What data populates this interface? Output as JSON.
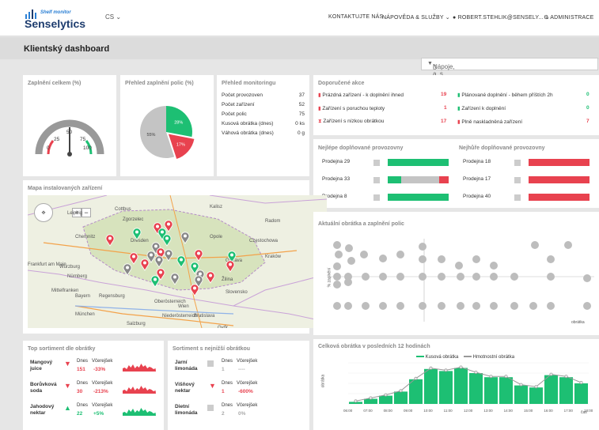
{
  "header": {
    "logo_small": "Shelf monitor",
    "logo_name": "Senselytics",
    "lang": "CS",
    "contact": "KONTAKTUJTE NÁS",
    "help": "NÁPOVĚDA & SLUŽBY",
    "user": "ROBERT.STEHLIK@SENSELY...",
    "admin": "ADMINISTRACE"
  },
  "page": {
    "title": "Klientský dashboard"
  },
  "filter": {
    "value": "Nápoje, a. s."
  },
  "gauge": {
    "title": "Zaplnění celkem (%)",
    "labels": [
      "0",
      "25",
      "50",
      "75",
      "100"
    ],
    "value": 50
  },
  "pie": {
    "title": "Přehled zaplnění polic (%)",
    "slices": [
      {
        "label": "28%",
        "value": 28,
        "color": "#1dbf73"
      },
      {
        "label": "17%",
        "value": 17,
        "color": "#e8424f"
      },
      {
        "label": "55%",
        "value": 55,
        "color": "#c4c4c4"
      }
    ]
  },
  "monitoring": {
    "title": "Přehled monitoringu",
    "rows": [
      {
        "label": "Počet provozoven",
        "value": "37"
      },
      {
        "label": "Počet zařízení",
        "value": "52"
      },
      {
        "label": "Počet polic",
        "value": "75"
      },
      {
        "label": "Kusová obrátka (dnes)",
        "value": "0 ks"
      },
      {
        "label": "Váhová obrátka (dnes)",
        "value": "0 g"
      }
    ]
  },
  "actions": {
    "title": "Doporučené akce",
    "left": [
      {
        "label": "Prázdná zařízení - k doplnění ihned",
        "value": "19"
      },
      {
        "label": "Zařízení s poruchou teploty",
        "value": "1"
      },
      {
        "label": "Zařízení s nízkou obrátkou",
        "value": "17"
      }
    ],
    "right": [
      {
        "label": "Plánované doplnění - během příštích 2h",
        "value": "0"
      },
      {
        "label": "Zařízení k doplnění",
        "value": "0"
      },
      {
        "label": "Plně naskladněná zařízení",
        "value": "7"
      }
    ]
  },
  "best": {
    "title": "Nejlépe doplňované provozovny",
    "rows": [
      {
        "label": "Prodejna 29",
        "green": 1.0
      },
      {
        "label": "Prodejna 33",
        "green": 0.22,
        "gray": 0.62
      },
      {
        "label": "Prodejna 8",
        "green": 1.0
      }
    ]
  },
  "worst": {
    "title": "Nejhůře doplňované provozovny",
    "rows": [
      {
        "label": "Prodejna 18"
      },
      {
        "label": "Prodejna 17"
      },
      {
        "label": "Prodejna 40"
      }
    ]
  },
  "map": {
    "title": "Mapa instalovaných zařízení",
    "places": [
      "Leipzig",
      "Chemnitz",
      "Dresden",
      "Cottbus",
      "Zgorzelec",
      "Kalisz",
      "Radom",
      "Opole",
      "Częstochowa",
      "Kraków",
      "Ostrava",
      "Žilina",
      "Slovensko",
      "Wien",
      "Bratislava",
      "Győr",
      "München",
      "Salzburg",
      "Nürnberg",
      "Würzburg",
      "Mittelfranken",
      "Oberösterreich",
      "Bayern",
      "Frankfurt am Main",
      "Niederösterreich",
      "Regensburg"
    ]
  },
  "scatter": {
    "title": "Aktuální obrátka a zaplnění polic",
    "ylabel": "% zaplnění",
    "xlabel": "obrátka"
  },
  "top": {
    "title": "Top sortiment dle obrátky",
    "dnes": "Dnes",
    "vcera": "Včerejšek",
    "items": [
      {
        "name": "Mangový juice",
        "today": "151",
        "change": "-33%",
        "dir": "down"
      },
      {
        "name": "Borůvková soda",
        "today": "30",
        "change": "-213%",
        "dir": "down"
      },
      {
        "name": "Jahodový nektar",
        "today": "22",
        "change": "+5%",
        "dir": "up"
      }
    ]
  },
  "low": {
    "title": "Sortiment s nejnižší obrátkou",
    "dnes": "Dnes",
    "vcera": "Včerejšek",
    "items": [
      {
        "name": "Jarní limonáda",
        "today": "1",
        "change": "----",
        "dir": "none"
      },
      {
        "name": "Višňový nektar",
        "today": "1",
        "change": "-600%",
        "dir": "down"
      },
      {
        "name": "Dietní limonáda",
        "today": "2",
        "change": "0%",
        "dir": "none"
      }
    ]
  },
  "turnover": {
    "title": "Celková obrátka v posledních 12 hodinách",
    "legend1": "Kusová obrátka",
    "legend2": "Hmotnostní obrátka",
    "ylabel": "obrátka",
    "xunit": "čas",
    "times": [
      "06:00",
      "07:00",
      "08:00",
      "09:00",
      "10:00",
      "11:00",
      "12:00",
      "13:00",
      "14:00",
      "15:00",
      "16:00",
      "17:00",
      "18:00"
    ]
  },
  "chart_data": {
    "type": "bar",
    "title": "Celková obrátka v posledních 12 hodinách",
    "categories": [
      "06:00",
      "07:00",
      "08:00",
      "09:00",
      "10:00",
      "11:00",
      "12:00",
      "13:00",
      "14:00",
      "15:00",
      "16:00",
      "17:00",
      "18:00"
    ],
    "series": [
      {
        "name": "Kusová obrátka",
        "values": [
          2,
          5,
          8,
          12,
          24,
          34,
          32,
          35,
          30,
          26,
          26,
          18,
          16,
          28,
          26,
          20
        ]
      },
      {
        "name": "Hmotnostní obrátka",
        "values": [
          2,
          5,
          8,
          12,
          24,
          34,
          32,
          35,
          30,
          26,
          26,
          18,
          16,
          28,
          26,
          20
        ]
      }
    ],
    "ylim": [
      0,
      40
    ]
  }
}
